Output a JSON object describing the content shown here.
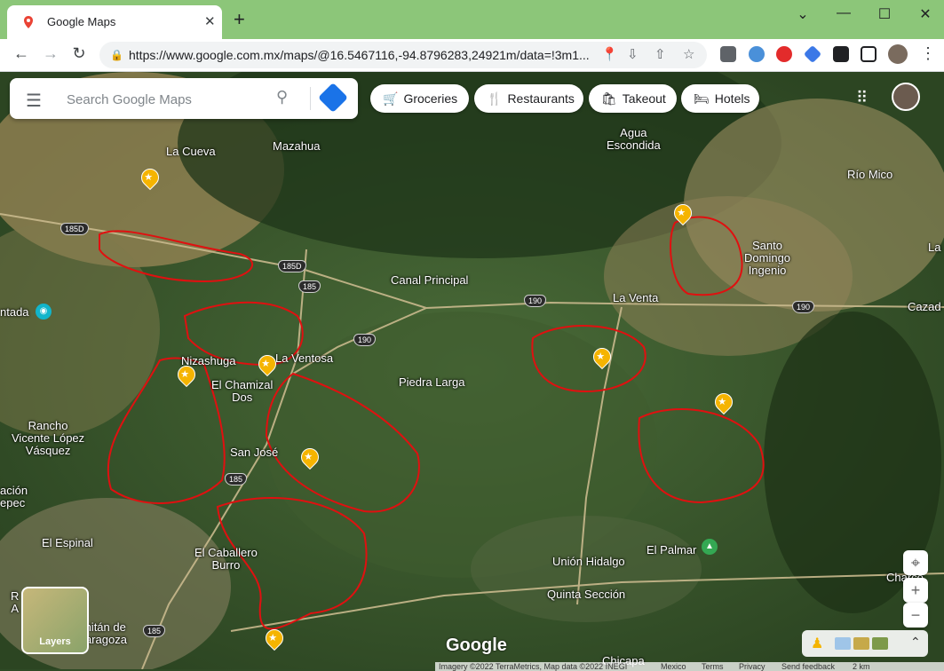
{
  "browser": {
    "tab_title": "Google Maps",
    "new_tab": "+",
    "url": "https://www.google.com.mx/maps/@16.5467116,-94.8796283,24921m/data=!3m1...",
    "window_controls": [
      "⌄",
      "—",
      "☐",
      "✕"
    ]
  },
  "search": {
    "placeholder": "Search Google Maps"
  },
  "chips": [
    {
      "label": "Groceries",
      "icon": "cart-icon",
      "glyph": "🛒"
    },
    {
      "label": "Restaurants",
      "icon": "fork-knife-icon",
      "glyph": "🍴"
    },
    {
      "label": "Takeout",
      "icon": "takeout-bag-icon",
      "glyph": "🛍"
    },
    {
      "label": "Hotels",
      "icon": "bed-icon",
      "glyph": "🛏"
    }
  ],
  "places": {
    "la_cueva": "La Cueva",
    "mazahua": "Mazahua",
    "agua_escondida": "Agua\nEscondida",
    "rio_mico": "Río Mico",
    "santo_domingo": "Santo\nDomingo\nIngenio",
    "canal_principal": "Canal Principal",
    "la_venta": "La Venta",
    "cazad": "Cazad",
    "la": "La",
    "ntada": "ntada",
    "nizashuga": "Nizashuga",
    "la_ventosa": "La Ventosa",
    "el_chamizal": "El Chamizal\nDos",
    "piedra_larga": "Piedra Larga",
    "rancho": "Rancho\nVicente López\nVásquez",
    "san_jose": "San José",
    "acion": "ación\nepec",
    "el_espinal": "El Espinal",
    "el_caballero": "El Caballero\nBurro",
    "union_hidalgo": "Unión Hidalgo",
    "el_palmar": "El Palmar",
    "quinta_seccion": "Quinta Sección",
    "charco": "Charco",
    "chitan": "chitán de\nZaragoza",
    "chicapa": "Chicapa",
    "r_a": "R\nA"
  },
  "shields": [
    "185D",
    "185D",
    "185",
    "190",
    "190",
    "190",
    "185",
    "185"
  ],
  "map_controls": {
    "layers_label": "Layers",
    "google_logo": "Google",
    "zoom_in": "+",
    "zoom_out": "−",
    "location": "⌖",
    "expand": "⌃"
  },
  "footer": {
    "imagery": "Imagery ©2022 TerraMetrics, Map data ©2022 INEGI",
    "country": "Mexico",
    "terms": "Terms",
    "privacy": "Privacy",
    "feedback": "Send feedback",
    "scale": "2 km"
  },
  "colors": {
    "title_bar": "#8cc679",
    "annotation_red": "#e01010",
    "pin": "#f5b400",
    "accent_blue": "#1a73e8"
  }
}
